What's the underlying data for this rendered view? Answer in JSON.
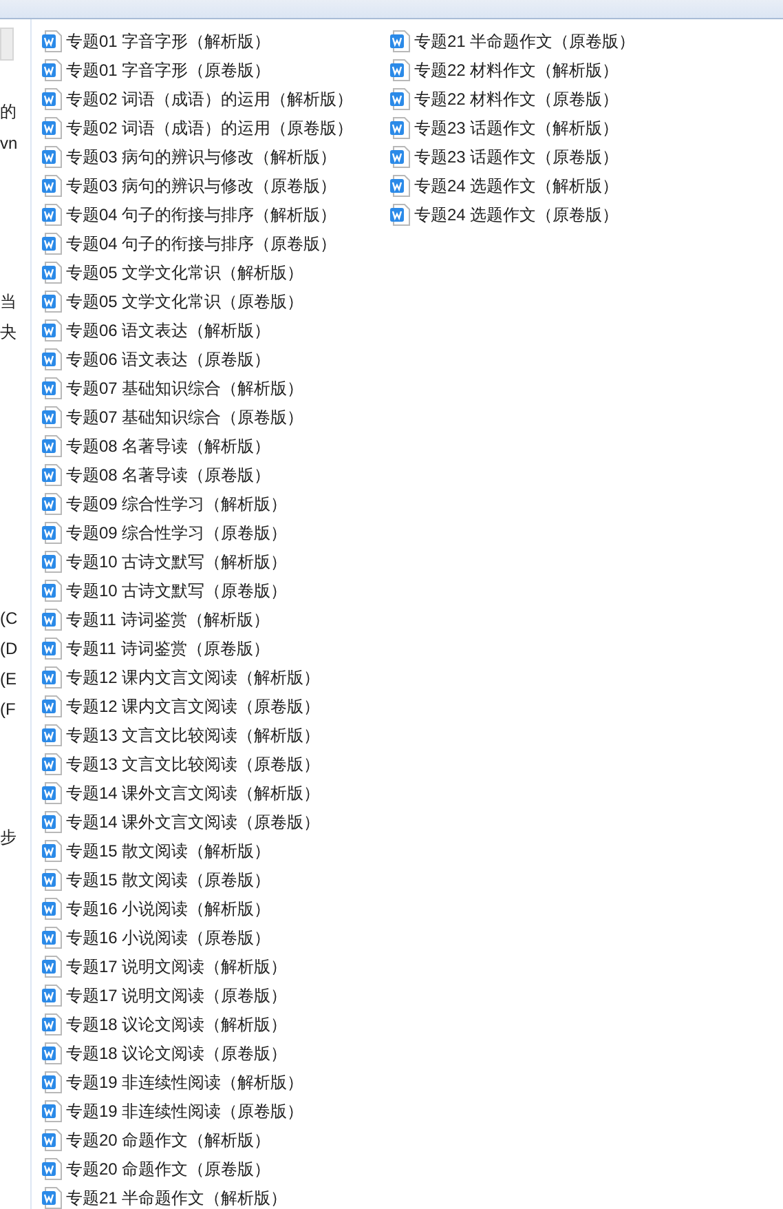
{
  "sidebar": {
    "items": [
      "的",
      "vn",
      "当",
      "夬",
      "(C",
      "(D",
      "(E",
      "(F",
      "步"
    ]
  },
  "files": [
    "专题01 字音字形（解析版）",
    "专题01 字音字形（原卷版）",
    "专题02 词语（成语）的运用（解析版）",
    "专题02 词语（成语）的运用（原卷版）",
    "专题03 病句的辨识与修改（解析版）",
    "专题03 病句的辨识与修改（原卷版）",
    "专题04 句子的衔接与排序（解析版）",
    "专题04 句子的衔接与排序（原卷版）",
    "专题05 文学文化常识（解析版）",
    "专题05 文学文化常识（原卷版）",
    "专题06 语文表达（解析版）",
    "专题06 语文表达（原卷版）",
    "专题07 基础知识综合（解析版）",
    "专题07 基础知识综合（原卷版）",
    "专题08 名著导读（解析版）",
    "专题08 名著导读（原卷版）",
    "专题09 综合性学习（解析版）",
    "专题09 综合性学习（原卷版）",
    "专题10 古诗文默写（解析版）",
    "专题10 古诗文默写（原卷版）",
    "专题11 诗词鉴赏（解析版）",
    "专题11 诗词鉴赏（原卷版）",
    "专题12 课内文言文阅读（解析版）",
    "专题12 课内文言文阅读（原卷版）",
    "专题13 文言文比较阅读（解析版）",
    "专题13 文言文比较阅读（原卷版）",
    "专题14 课外文言文阅读（解析版）",
    "专题14 课外文言文阅读（原卷版）",
    "专题15 散文阅读（解析版）",
    "专题15 散文阅读（原卷版）",
    "专题16 小说阅读（解析版）",
    "专题16 小说阅读（原卷版）",
    "专题17 说明文阅读（解析版）",
    "专题17 说明文阅读（原卷版）",
    "专题18 议论文阅读（解析版）",
    "专题18 议论文阅读（原卷版）",
    "专题19 非连续性阅读（解析版）",
    "专题19 非连续性阅读（原卷版）",
    "专题20 命题作文（解析版）",
    "专题20 命题作文（原卷版）",
    "专题21 半命题作文（解析版）",
    "专题21 半命题作文（原卷版）",
    "专题22 材料作文（解析版）",
    "专题22 材料作文（原卷版）",
    "专题23 话题作文（解析版）",
    "专题23 话题作文（原卷版）",
    "专题24 选题作文（解析版）",
    "专题24 选题作文（原卷版）"
  ]
}
